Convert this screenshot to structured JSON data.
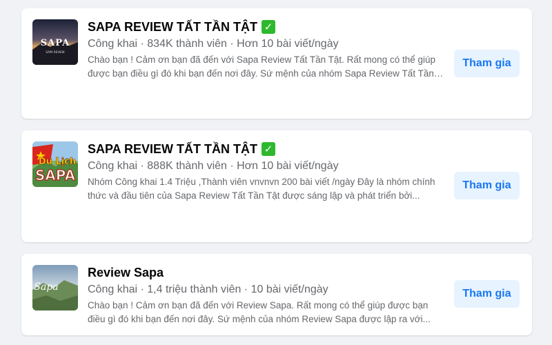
{
  "groups": [
    {
      "title": "SAPA REVIEW TẤT TẦN TẬT",
      "check_icon": "✓",
      "meta": "Công khai · 834K thành viên · Hơn 10 bài viết/ngày",
      "description": "Chào bạn ! Cảm ơn bạn đã đến với Sapa Review Tất Tần Tật. Rất mong có thể giúp được bạn điều gì đó khi bạn đến nơi đây. Sứ mệnh của nhóm Sapa Review Tất Tần Tật được lập ra với...",
      "thumb_text": "SAPA",
      "thumb_subtext": "SAPA REVIEW",
      "join_label": "Tham gia"
    },
    {
      "title": "SAPA REVIEW TẤT TẦN TẬT",
      "check_icon": "✓",
      "meta": "Công khai · 888K thành viên · Hơn 10 bài viết/ngày",
      "description": "Nhóm Công khai 1.4 Triệu ,Thành viên vnvnvn 200 bài viết /ngày Đây là nhóm chính thức và đầu tiên của Sapa Review Tất Tần Tật được sáng lập và phát triển bởi...",
      "thumb_text_top": "Du Lịch",
      "thumb_text": "SAPA",
      "join_label": "Tham gia"
    },
    {
      "title": "Review Sapa",
      "meta": "Công khai · 1,4 triệu thành viên · 10 bài viết/ngày",
      "description": "Chào bạn ! Cảm ơn bạn đã đến với Review Sapa. Rất mong có thể giúp được bạn điều gì đó khi bạn đến nơi đây. Sứ mệnh của nhóm Review Sapa được lập ra với...",
      "thumb_text": "Sapa",
      "join_label": "Tham gia"
    }
  ],
  "colors": {
    "accent": "#1877f2",
    "button_bg": "#e7f3ff",
    "check": "#2eb82e",
    "flag_red": "#da251d",
    "flag_star": "#ffcd00"
  }
}
